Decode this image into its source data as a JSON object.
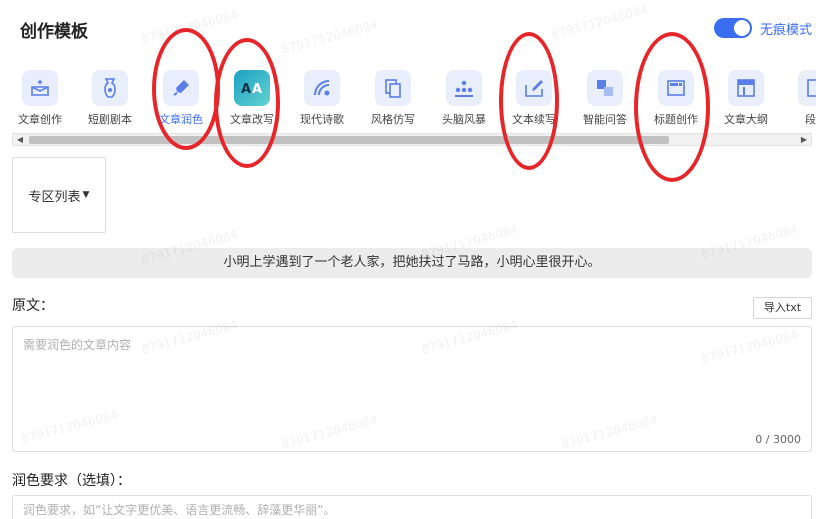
{
  "header": {
    "title": "创作模板",
    "mode_label": "无痕模式",
    "mode_on": true
  },
  "tools": [
    {
      "label": "文章创作",
      "icon": "box-sparkle-icon"
    },
    {
      "label": "短剧剧本",
      "icon": "vase-icon"
    },
    {
      "label": "文章润色",
      "icon": "brush-icon",
      "active": true
    },
    {
      "label": "文章改写",
      "icon": "translate-icon"
    },
    {
      "label": "现代诗歌",
      "icon": "wifi-icon"
    },
    {
      "label": "风格仿写",
      "icon": "copy-icon"
    },
    {
      "label": "头脑风暴",
      "icon": "people-icon"
    },
    {
      "label": "文本续写",
      "icon": "edit-box-icon"
    },
    {
      "label": "智能问答",
      "icon": "qa-icon"
    },
    {
      "label": "标题创作",
      "icon": "title-card-icon"
    },
    {
      "label": "文章大纲",
      "icon": "outline-icon"
    },
    {
      "label": "段落",
      "icon": "paragraph-icon"
    }
  ],
  "zone": {
    "label": "专区列表"
  },
  "sample": {
    "text": "小明上学遇到了一个老人家，把她扶过了马路，小明心里很开心。"
  },
  "original": {
    "label": "原文：",
    "import_label": "导入txt",
    "placeholder": "需要润色的文章内容",
    "counter": "0 / 3000"
  },
  "requirement": {
    "label": "润色要求（选填）：",
    "placeholder": "润色要求，如“让文字更优美、语言更流畅、辞藻更华丽”。"
  },
  "watermark": "8791712046084",
  "colors": {
    "accent": "#3a6df0",
    "annotation": "#e8262a"
  }
}
